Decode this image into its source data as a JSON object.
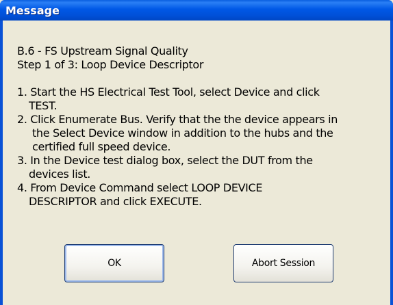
{
  "window": {
    "title": "Message"
  },
  "message": {
    "lines": [
      "B.6 - FS Upstream Signal Quality",
      "Step 1 of 3: Loop Device Descriptor",
      "1. Start the HS Electrical Test Tool, select Device and click",
      "TEST.",
      "2. Click Enumerate Bus.  Verify that the the device appears in",
      "the Select Device window in addition to the hubs and the",
      "certified full speed device.",
      "3. In the Device test dialog box, select the DUT from the",
      "devices list.",
      "4. From Device Command select LOOP DEVICE",
      "DESCRIPTOR and click EXECUTE."
    ]
  },
  "buttons": {
    "ok_label": "OK",
    "abort_label": "Abort Session"
  }
}
